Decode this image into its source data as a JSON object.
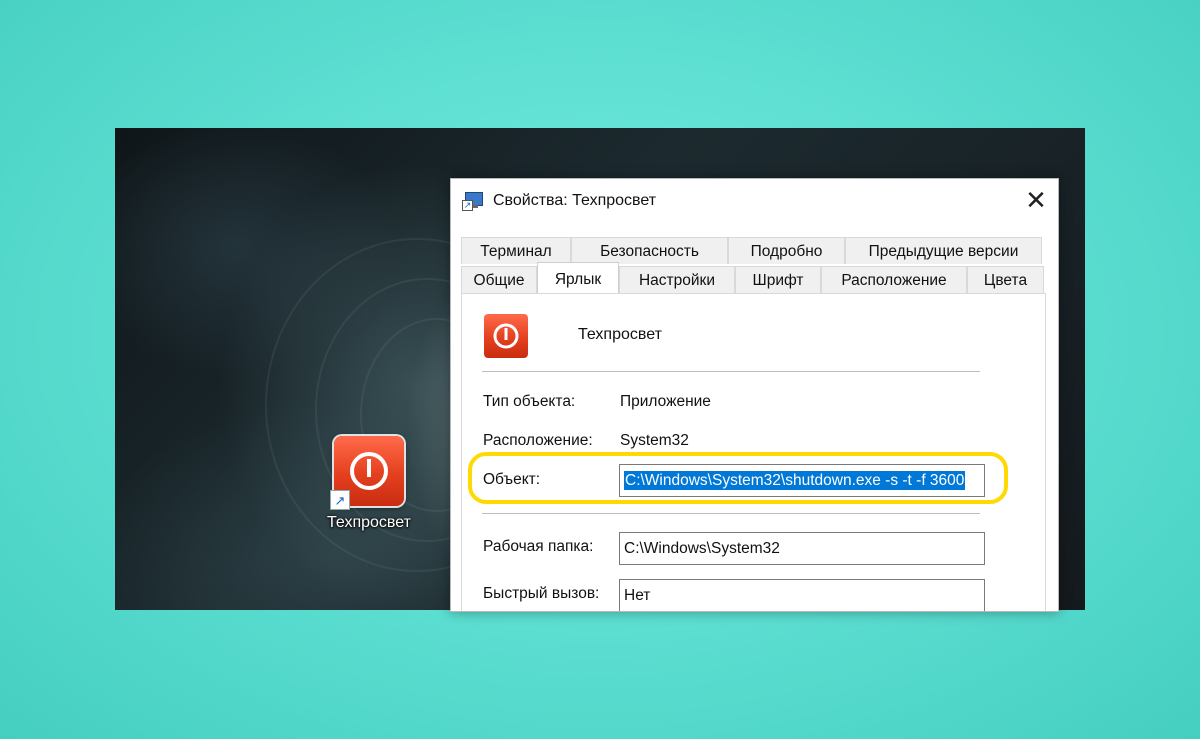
{
  "desktop": {
    "shortcut": {
      "label": "Техпросвет"
    }
  },
  "dialog": {
    "title": "Свойства: Техпросвет",
    "close_glyph": "✕",
    "tabs_back": [
      "Терминал",
      "Безопасность",
      "Подробно",
      "Предыдущие версии"
    ],
    "tabs_front": [
      "Общие",
      "Ярлык",
      "Настройки",
      "Шрифт",
      "Расположение",
      "Цвета"
    ],
    "active_tab": "Ярлык",
    "app_name": "Техпросвет",
    "target_type_label": "Тип объекта:",
    "target_type_value": "Приложение",
    "location_label": "Расположение:",
    "location_value": "System32",
    "target_label": "Объект:",
    "target_value": "C:\\Windows\\System32\\shutdown.exe -s -t -f 3600",
    "start_in_label": "Рабочая папка:",
    "start_in_value": "C:\\Windows\\System32",
    "hotkey_label": "Быстрый вызов:",
    "hotkey_value": "Нет"
  },
  "colors": {
    "background": "#5fe0d3",
    "highlight_ring": "#ffd900",
    "selection": "#0078d7",
    "icon_red": "#e4401f"
  },
  "icons": {
    "app": "power-icon",
    "shortcut_overlay": "shortcut-arrow-icon",
    "title": "shortcut-properties-icon",
    "close": "close-icon"
  }
}
